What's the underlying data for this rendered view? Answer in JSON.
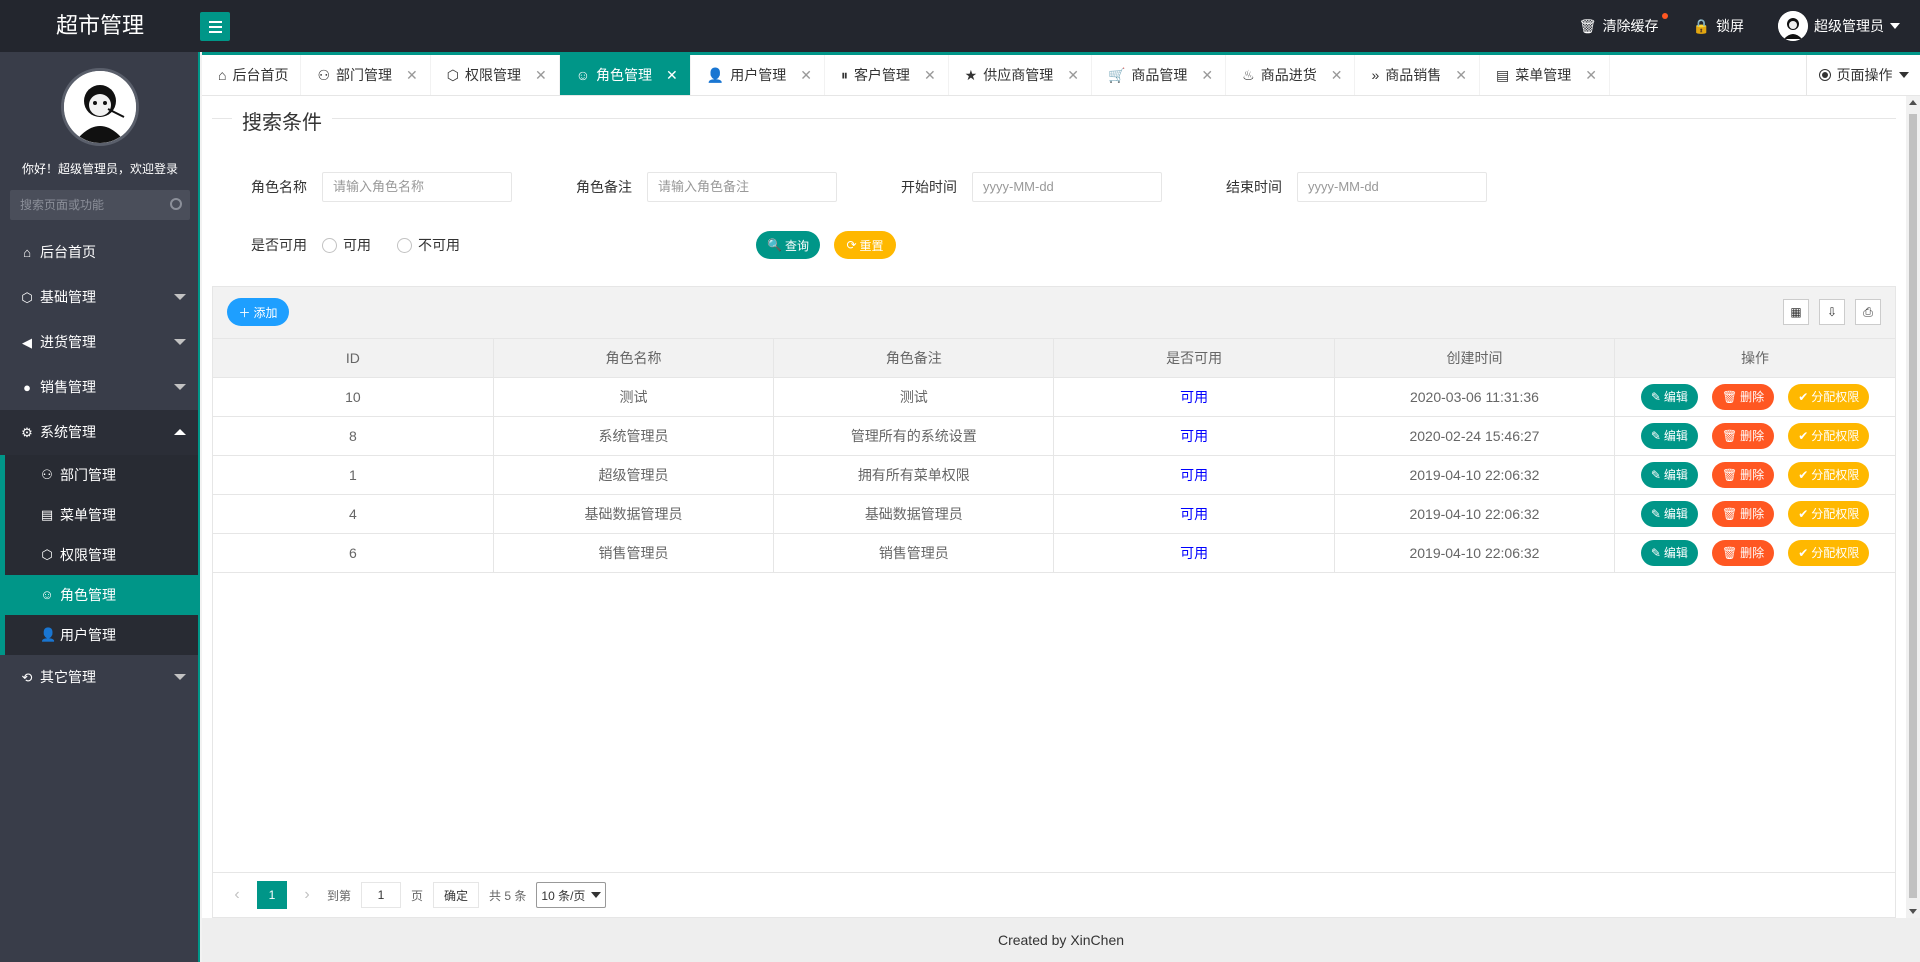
{
  "app": {
    "title": "超市管理"
  },
  "topbar": {
    "clear_cache": "清除缓存",
    "lock_screen": "锁屏",
    "user_name": "超级管理员"
  },
  "sidebar": {
    "welcome": "你好！超级管理员，欢迎登录",
    "search_placeholder": "搜索页面或功能",
    "items": [
      {
        "label": "后台首页",
        "icon": "home-icon"
      },
      {
        "label": "基础管理",
        "icon": "cube-icon"
      },
      {
        "label": "进货管理",
        "icon": "volume-icon"
      },
      {
        "label": "销售管理",
        "icon": "chat-icon"
      },
      {
        "label": "系统管理",
        "icon": "gear-icon"
      },
      {
        "label": "其它管理",
        "icon": "refresh-icon"
      }
    ],
    "sub_items": [
      {
        "label": "部门管理",
        "icon": "user-outline-icon"
      },
      {
        "label": "菜单管理",
        "icon": "menu-icon"
      },
      {
        "label": "权限管理",
        "icon": "cube-icon"
      },
      {
        "label": "角色管理",
        "icon": "smile-icon"
      },
      {
        "label": "用户管理",
        "icon": "user-icon"
      }
    ]
  },
  "tabs": [
    {
      "label": "后台首页",
      "icon": "home-icon"
    },
    {
      "label": "部门管理",
      "icon": "user-outline-icon"
    },
    {
      "label": "权限管理",
      "icon": "cube-icon"
    },
    {
      "label": "角色管理",
      "icon": "smile-icon"
    },
    {
      "label": "用户管理",
      "icon": "user-icon"
    },
    {
      "label": "客户管理",
      "icon": "pause-icon"
    },
    {
      "label": "供应商管理",
      "icon": "star-icon"
    },
    {
      "label": "商品管理",
      "icon": "cart-icon"
    },
    {
      "label": "商品进货",
      "icon": "fire-icon"
    },
    {
      "label": "商品销售",
      "icon": "double-chevron-icon"
    },
    {
      "label": "菜单管理",
      "icon": "menu-icon"
    }
  ],
  "page_op": "页面操作",
  "search": {
    "legend": "搜索条件",
    "role_name_label": "角色名称",
    "role_name_placeholder": "请输入角色名称",
    "role_remark_label": "角色备注",
    "role_remark_placeholder": "请输入角色备注",
    "start_label": "开始时间",
    "start_placeholder": "yyyy-MM-dd",
    "end_label": "结束时间",
    "end_placeholder": "yyyy-MM-dd",
    "available_label": "是否可用",
    "opt_yes": "可用",
    "opt_no": "不可用",
    "query_btn": "查询",
    "reset_btn": "重置"
  },
  "table": {
    "add_btn": "添加",
    "columns": [
      "ID",
      "角色名称",
      "角色备注",
      "是否可用",
      "创建时间",
      "操作"
    ],
    "rows": [
      {
        "id": "10",
        "name": "测试",
        "remark": "测试",
        "available": "可用",
        "created": "2020-03-06 11:31:36"
      },
      {
        "id": "8",
        "name": "系统管理员",
        "remark": "管理所有的系统设置",
        "available": "可用",
        "created": "2020-02-24 15:46:27"
      },
      {
        "id": "1",
        "name": "超级管理员",
        "remark": "拥有所有菜单权限",
        "available": "可用",
        "created": "2019-04-10 22:06:32"
      },
      {
        "id": "4",
        "name": "基础数据管理员",
        "remark": "基础数据管理员",
        "available": "可用",
        "created": "2019-04-10 22:06:32"
      },
      {
        "id": "6",
        "name": "销售管理员",
        "remark": "销售管理员",
        "available": "可用",
        "created": "2019-04-10 22:06:32"
      }
    ],
    "edit_btn": "编辑",
    "delete_btn": "删除",
    "assign_btn": "分配权限"
  },
  "pager": {
    "current": "1",
    "goto_label": "到第",
    "goto_value": "1",
    "page_unit": "页",
    "confirm": "确定",
    "total": "共 5 条",
    "page_size": "10 条/页"
  },
  "footer": "Created by XinChen",
  "colors": {
    "accent": "#009688",
    "warn": "#ffb800",
    "danger": "#ff5722",
    "info": "#1e9fff",
    "dark": "#23262e"
  }
}
